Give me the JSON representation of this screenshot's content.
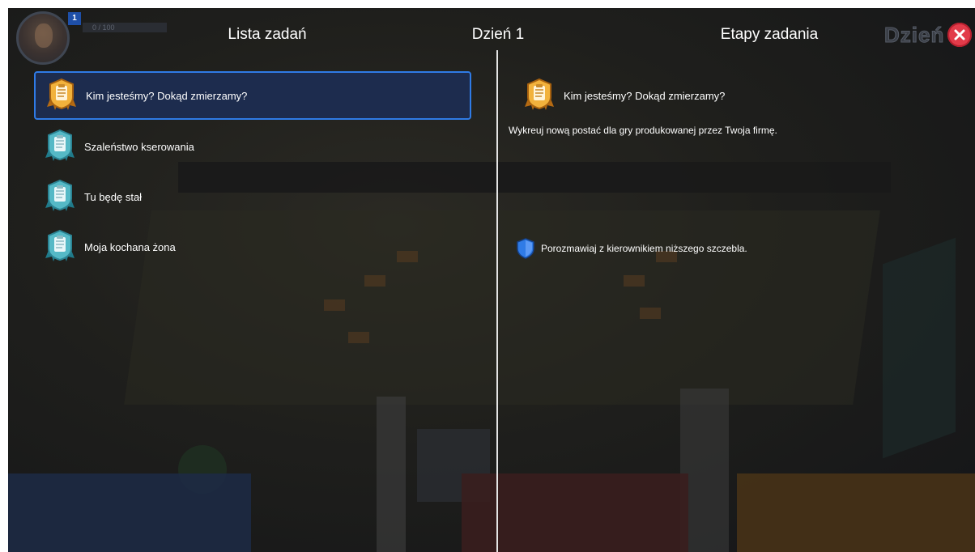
{
  "hud": {
    "level": "1",
    "cash": "0 / 100"
  },
  "headers": {
    "task_list": "Lista zadań",
    "day": "Dzień 1",
    "task_stages": "Etapy zadania",
    "ghost_label": "Dzień"
  },
  "tasks": [
    {
      "label": "Kim jesteśmy? Dokąd zmierzamy?",
      "badge": "gold-clipboard-badge-icon",
      "selected": true
    },
    {
      "label": "Szaleństwo kserowania",
      "badge": "teal-clipboard-badge-icon",
      "selected": false
    },
    {
      "label": "Tu będę stał",
      "badge": "teal-clipboard-badge-icon",
      "selected": false
    },
    {
      "label": "Moja kochana żona",
      "badge": "teal-clipboard-badge-icon",
      "selected": false
    }
  ],
  "detail": {
    "title": "Kim jesteśmy? Dokąd zmierzamy?",
    "description": "Wykreuj nową postać dla gry produkowanej przez Twoja firmę.",
    "stages": [
      {
        "label": "Porozmawiaj z kierownikiem niższego szczebla.",
        "icon": "blue-shield-icon"
      }
    ]
  },
  "colors": {
    "selection_border": "#2f7be6",
    "selection_fill": "#1d2c4e",
    "close": "#e23b4a",
    "gold_badge": "#e9a93a",
    "teal_badge": "#3fa7b5"
  }
}
